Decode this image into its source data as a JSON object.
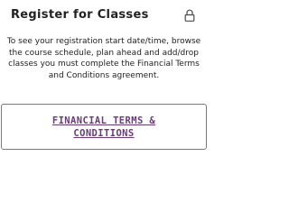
{
  "card": {
    "title": "Register for Classes",
    "lock_icon": "lock-icon",
    "description": "To see your registration start date/time, browse the course schedule, plan ahead and add/drop classes you must complete the Financial Terms and Conditions agreement.",
    "terms_button_label": "FINANCIAL TERMS & CONDITIONS"
  },
  "colors": {
    "link": "#6b3a7d",
    "text": "#222222",
    "border": "#7a7a7a"
  }
}
